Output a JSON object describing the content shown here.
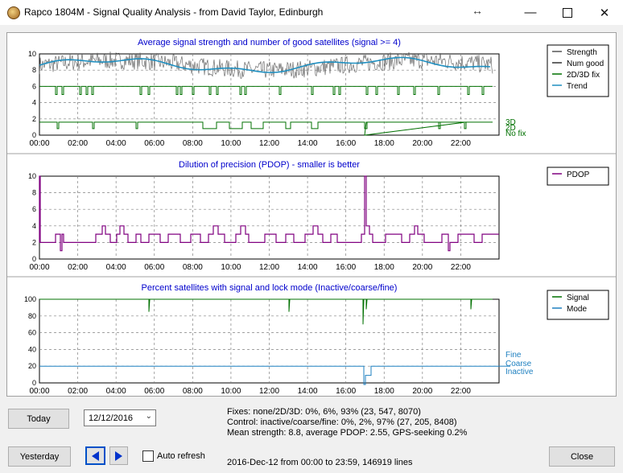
{
  "window": {
    "title": "Rapco 1804M - Signal Quality Analysis - from David Taylor, Edinburgh",
    "resize_icon": "double-arrow-icon",
    "minimize_icon": "minimize-icon",
    "maximize_icon": "maximize-icon",
    "close_icon": "close-icon"
  },
  "colors": {
    "strength": "#555555",
    "trend": "#1f8fc0",
    "green": "#007000",
    "pdop": "#800080",
    "mode": "#1f80c0",
    "title_blue": "#0000cc",
    "grid": "#808080"
  },
  "time_labels": [
    "00:00",
    "02:00",
    "04:00",
    "06:00",
    "08:00",
    "10:00",
    "12:00",
    "14:00",
    "16:00",
    "18:00",
    "20:00",
    "22:00"
  ],
  "charts": [
    {
      "title": "Average signal strength and number of good satellites (signal >= 4)",
      "y_ticks": [
        "0",
        "2",
        "4",
        "6",
        "8",
        "10"
      ],
      "right_labels": [
        "3D",
        "2D",
        "No fix"
      ],
      "legend": [
        {
          "label": "Strength",
          "color": "#555555"
        },
        {
          "label": "Num good",
          "color": "#333333"
        },
        {
          "label": "2D/3D fix",
          "color": "#007000"
        },
        {
          "label": "Trend",
          "color": "#1f8fc0"
        }
      ]
    },
    {
      "title": "Dilution of precision (PDOP) - smaller is better",
      "y_ticks": [
        "0",
        "2",
        "4",
        "6",
        "8",
        "10"
      ],
      "right_labels": [],
      "legend": [
        {
          "label": "PDOP",
          "color": "#800080"
        }
      ]
    },
    {
      "title": "Percent satellites with signal and lock mode (Inactive/coarse/fine)",
      "y_ticks": [
        "0",
        "20",
        "40",
        "60",
        "80",
        "100"
      ],
      "right_labels": [
        "Fine",
        "Coarse",
        "Inactive"
      ],
      "legend": [
        {
          "label": "Signal",
          "color": "#007000"
        },
        {
          "label": "Mode",
          "color": "#1f80c0"
        }
      ]
    }
  ],
  "controls": {
    "today_label": "Today",
    "date_value": "12/12/2016",
    "yesterday_label": "Yesterday",
    "prev_icon": "left-arrow-icon",
    "next_icon": "right-arrow-icon",
    "auto_refresh_label": "Auto refresh",
    "close_label": "Close"
  },
  "stats": {
    "fixes": "Fixes: none/2D/3D:  0%, 6%, 93%  (23, 547, 8070)",
    "control": "Control: inactive/coarse/fine:  0%, 2%, 97%  (27, 205, 8408)",
    "mean": "Mean strength: 8.8,  average PDOP: 2.55,  GPS-seeking 0.2%",
    "range": "2016-Dec-12 from 00:00 to 23:59, 146919 lines"
  }
}
